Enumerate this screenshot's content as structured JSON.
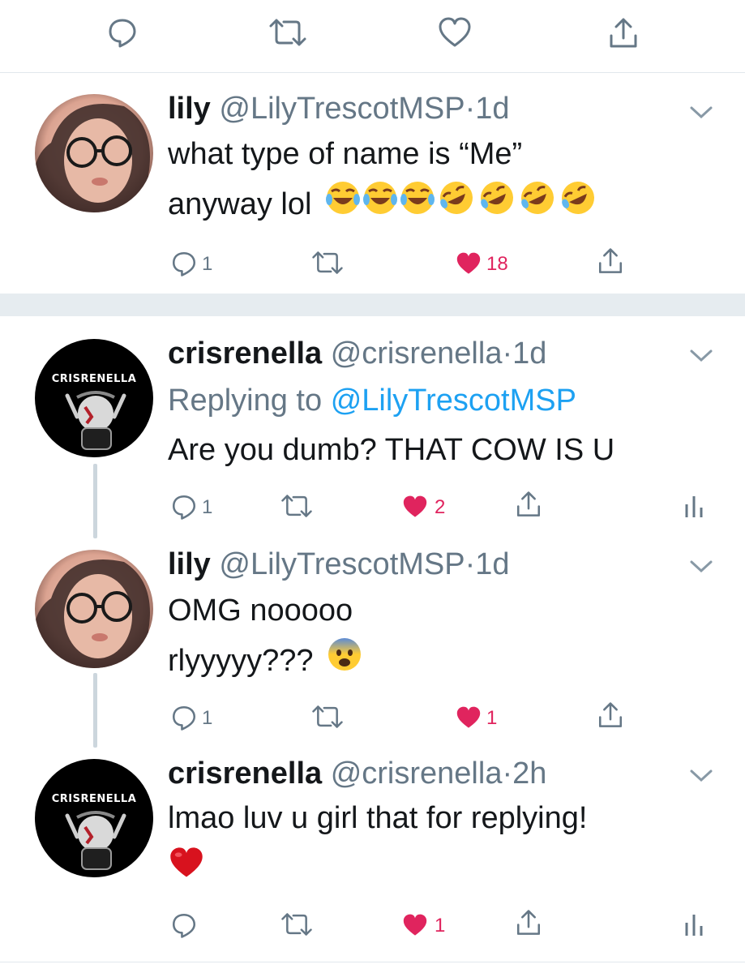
{
  "colors": {
    "gray": "#657786",
    "blue": "#1da1f2",
    "like_red": "#e0245e",
    "divider": "#e1e8ed"
  },
  "top_actions": {
    "icons": [
      "reply-icon",
      "retweet-icon",
      "like-icon",
      "share-icon"
    ]
  },
  "tweets": [
    {
      "name": "lily",
      "handle": "@LilyTrescotMSP",
      "dot": "·",
      "time": "1d",
      "text_line1": "what type of name is “Me”",
      "text_line2": "anyway lol",
      "emojis": [
        "face-with-tears-of-joy",
        "face-with-tears-of-joy",
        "face-with-tears-of-joy",
        "rolling-on-the-floor-laughing",
        "rolling-on-the-floor-laughing",
        "rolling-on-the-floor-laughing",
        "rolling-on-the-floor-laughing"
      ],
      "reply_count": "1",
      "like_count": "18",
      "liked": true
    },
    {
      "name": "crisrenella",
      "handle": "@crisrenella",
      "dot": "·",
      "time": "1d",
      "replying_prefix": "Replying to",
      "replying_to": "@LilyTrescotMSP",
      "text_line1": "Are you dumb? THAT COW IS U",
      "avatar_text": "CRISRENELLA",
      "reply_count": "1",
      "like_count": "2",
      "liked": true
    },
    {
      "name": "lily",
      "handle": "@LilyTrescotMSP",
      "dot": "·",
      "time": "1d",
      "text_line1": "OMG nooooo",
      "text_line2": "rlyyyyy???",
      "emojis": [
        "fearful-face"
      ],
      "reply_count": "1",
      "like_count": "1",
      "liked": true
    },
    {
      "name": "crisrenella",
      "handle": "@crisrenella",
      "dot": "·",
      "time": "2h",
      "text_line1": "lmao luv u girl that for replying!",
      "emojis": [
        "red-heart"
      ],
      "avatar_text": "CRISRENELLA",
      "like_count": "1",
      "liked": true
    }
  ]
}
